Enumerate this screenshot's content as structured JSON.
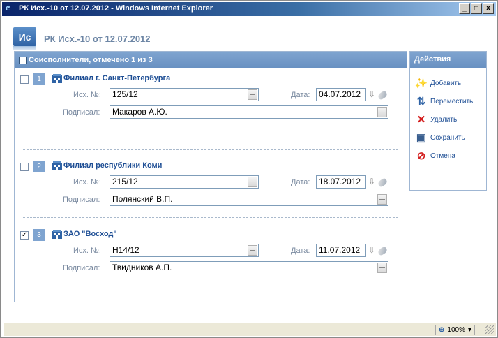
{
  "window": {
    "title": "РК Исх.-10 от 12.07.2012 - Windows Internet Explorer",
    "buttons": [
      "_",
      "□",
      "X"
    ]
  },
  "document": {
    "badge": "Ис",
    "title": "РК Исх.-10 от 12.07.2012"
  },
  "panel": {
    "header": "Соисполнители, отмечено 1 из 3"
  },
  "rows": [
    {
      "checked": false,
      "num": "1",
      "org": "Филиал г. Санкт-Петербурга",
      "out_label": "Исх. №:",
      "out_no": "125/12",
      "date_label": "Дата:",
      "date": "04.07.2012",
      "signed_label": "Подписал:",
      "signed": "Макаров А.Ю."
    },
    {
      "checked": false,
      "num": "2",
      "org": "Филиал республики Коми",
      "out_label": "Исх. №:",
      "out_no": "215/12",
      "date_label": "Дата:",
      "date": "18.07.2012",
      "signed_label": "Подписал:",
      "signed": "Полянский В.П."
    },
    {
      "checked": true,
      "num": "3",
      "org": "ЗАО \"Восход\"",
      "out_label": "Исх. №:",
      "out_no": "Н14/12",
      "date_label": "Дата:",
      "date": "11.07.2012",
      "signed_label": "Подписал:",
      "signed": "Твидников А.П."
    }
  ],
  "actions": {
    "header": "Действия",
    "items": [
      {
        "label": "Добавить",
        "icon": "add-icon"
      },
      {
        "label": "Переместить",
        "icon": "move-icon"
      },
      {
        "label": "Удалить",
        "icon": "delete-icon"
      },
      {
        "label": "Сохранить",
        "icon": "save-icon"
      },
      {
        "label": "Отмена",
        "icon": "cancel-icon"
      }
    ]
  },
  "status": {
    "zoom": "100%"
  },
  "colors": {
    "header": "#7fa4d0",
    "link": "#1f4f95",
    "label": "#7a8aa0"
  }
}
